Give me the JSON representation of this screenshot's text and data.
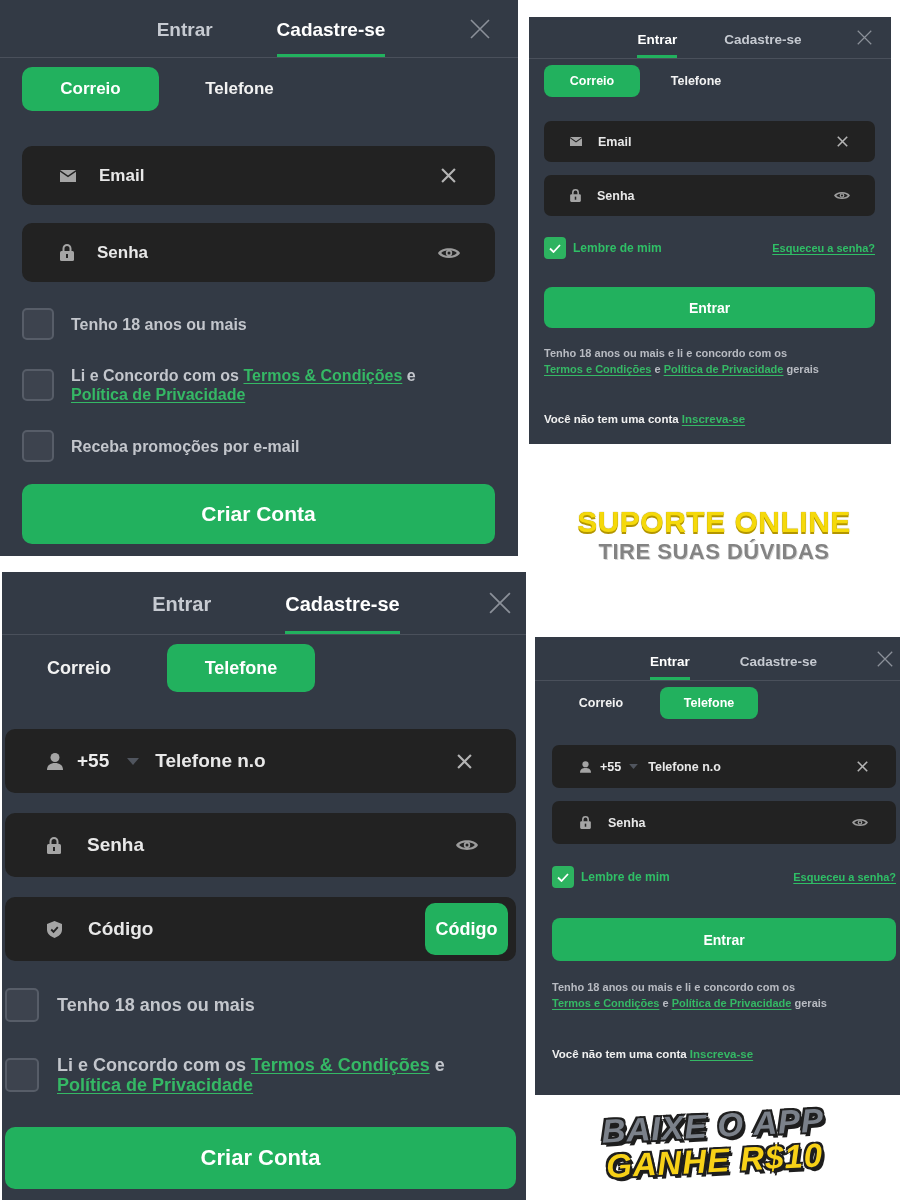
{
  "columns": [
    {
      "items": [
        {
          "kind": "register",
          "tabs": [
            {
              "label": "Entrar",
              "selected": false
            },
            {
              "label": "Cadastre-se",
              "selected": true
            }
          ],
          "methods": [
            {
              "label": "Correio",
              "selected": true
            },
            {
              "label": "Telefone",
              "selected": false
            }
          ],
          "fields": [
            {
              "kind": "email",
              "placeholder": "Email"
            },
            {
              "kind": "password",
              "placeholder": "Senha"
            }
          ],
          "agreements": [
            {
              "checked": false,
              "parts": [
                {
                  "kind": "text",
                  "text": "Tenho 18 anos ou mais"
                }
              ]
            },
            {
              "checked": false,
              "parts": [
                {
                  "kind": "text",
                  "text": "Li e Concordo com os "
                },
                {
                  "kind": "link",
                  "text": "Termos & Condições"
                },
                {
                  "kind": "text",
                  "text": " e "
                },
                {
                  "kind": "link",
                  "text": "Política de Privacidade"
                }
              ]
            },
            {
              "checked": false,
              "parts": [
                {
                  "kind": "text",
                  "text": "Receba promoções por e-mail"
                }
              ]
            }
          ],
          "submit": "Criar Conta"
        },
        {
          "kind": "register",
          "tabs": [
            {
              "label": "Entrar",
              "selected": false
            },
            {
              "label": "Cadastre-se",
              "selected": true
            }
          ],
          "methods": [
            {
              "label": "Correio",
              "selected": false
            },
            {
              "label": "Telefone",
              "selected": true
            }
          ],
          "fields": [
            {
              "kind": "phone",
              "country_code": "+55",
              "placeholder": "Telefone n.o"
            },
            {
              "kind": "password",
              "placeholder": "Senha"
            },
            {
              "kind": "code",
              "placeholder": "Código",
              "button": "Código"
            }
          ],
          "agreements": [
            {
              "checked": false,
              "parts": [
                {
                  "kind": "text",
                  "text": "Tenho 18 anos ou mais"
                }
              ]
            },
            {
              "checked": false,
              "parts": [
                {
                  "kind": "text",
                  "text": "Li e Concordo com os "
                },
                {
                  "kind": "link",
                  "text": "Termos & Condições"
                },
                {
                  "kind": "text",
                  "text": " e "
                },
                {
                  "kind": "link",
                  "text": "Política de Privacidade"
                }
              ]
            }
          ],
          "submit": "Criar Conta"
        }
      ]
    },
    {
      "items": [
        {
          "kind": "login",
          "tabs": [
            {
              "label": "Entrar",
              "selected": true
            },
            {
              "label": "Cadastre-se",
              "selected": false
            }
          ],
          "methods": [
            {
              "label": "Correio",
              "selected": true
            },
            {
              "label": "Telefone",
              "selected": false
            }
          ],
          "fields": [
            {
              "kind": "email",
              "placeholder": "Email"
            },
            {
              "kind": "password",
              "placeholder": "Senha"
            }
          ],
          "remember": {
            "label": "Lembre de mim",
            "checked": true
          },
          "forgot_link": "Esqueceu a senha?",
          "submit": "Entrar",
          "terms": [
            {
              "kind": "text",
              "text": "Tenho 18 anos ou mais e li e concordo com os "
            },
            {
              "kind": "link",
              "text": "Termos e Condições"
            },
            {
              "kind": "text",
              "text": " e "
            },
            {
              "kind": "link",
              "text": "Política de Privacidade"
            },
            {
              "kind": "text",
              "text": " gerais"
            }
          ],
          "signup_prompt": [
            {
              "kind": "text",
              "text": "Você não tem uma conta "
            },
            {
              "kind": "link",
              "text": "Inscreva-se"
            }
          ]
        },
        {
          "kind": "promo",
          "lines": [
            {
              "text": "SUPORTE ONLINE",
              "color": "#f5d90a"
            },
            {
              "text": "TIRE SUAS DÚVIDAS",
              "color": "#838383"
            }
          ]
        },
        {
          "kind": "login",
          "tabs": [
            {
              "label": "Entrar",
              "selected": true
            },
            {
              "label": "Cadastre-se",
              "selected": false
            }
          ],
          "methods": [
            {
              "label": "Correio",
              "selected": false
            },
            {
              "label": "Telefone",
              "selected": true
            }
          ],
          "fields": [
            {
              "kind": "phone",
              "country_code": "+55",
              "placeholder": "Telefone n.o"
            },
            {
              "kind": "password",
              "placeholder": "Senha"
            }
          ],
          "remember": {
            "label": "Lembre de mim",
            "checked": true
          },
          "forgot_link": "Esqueceu a senha?",
          "submit": "Entrar",
          "terms": [
            {
              "kind": "text",
              "text": "Tenho 18 anos ou mais e li e concordo com os "
            },
            {
              "kind": "link",
              "text": "Termos e Condições"
            },
            {
              "kind": "text",
              "text": " e "
            },
            {
              "kind": "link",
              "text": "Política de Privacidade"
            },
            {
              "kind": "text",
              "text": " gerais"
            }
          ],
          "signup_prompt": [
            {
              "kind": "text",
              "text": "Você não tem uma conta "
            },
            {
              "kind": "link",
              "text": "Inscreva-se"
            }
          ]
        },
        {
          "kind": "promo",
          "lines": [
            {
              "text": "BAIXE O APP",
              "color": "#7b818a"
            },
            {
              "text": "GANHE R$10",
              "color": "#f7d117"
            }
          ]
        }
      ]
    }
  ]
}
